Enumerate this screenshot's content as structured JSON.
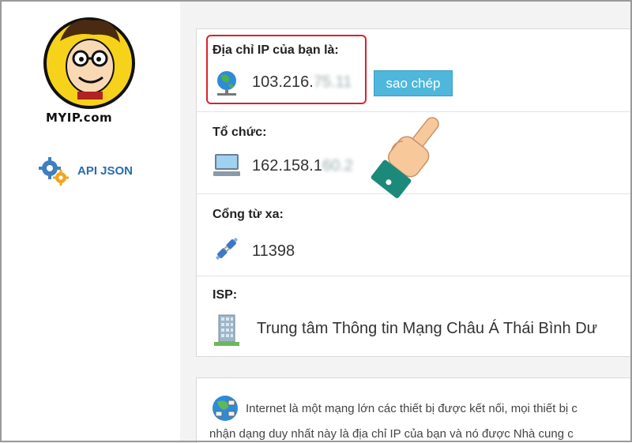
{
  "sidebar": {
    "logo_text": "MYIP.com",
    "api_label": "API JSON",
    "api_icon": "gears-icon"
  },
  "ip_section": {
    "title": "Địa chỉ IP của bạn là:",
    "value_visible": "103.216.",
    "value_blurred": "75.11",
    "icon": "globe-network-icon",
    "copy_button": "sao chép"
  },
  "org_section": {
    "title": "Tổ chức:",
    "value_visible": "162.158.1",
    "value_blurred": "60.2",
    "icon": "computer-icon"
  },
  "port_section": {
    "title": "Cổng từ xa:",
    "value": "11398",
    "icon": "plug-icon"
  },
  "isp_section": {
    "title": "ISP:",
    "value": "Trung tâm Thông tin Mạng Châu Á Thái Bình Dư",
    "icon": "building-icon"
  },
  "info": {
    "line1": "Internet là một mạng lớn các thiết bị được kết nối, mọi thiết bị c",
    "line2": "nhận dạng duy nhất này là địa chỉ IP của bạn và nó được Nhà cung c",
    "icon": "network-globe-icon"
  },
  "colors": {
    "accent": "#4fb7dc",
    "highlight": "#d8232a",
    "link": "#2a6cb0"
  }
}
